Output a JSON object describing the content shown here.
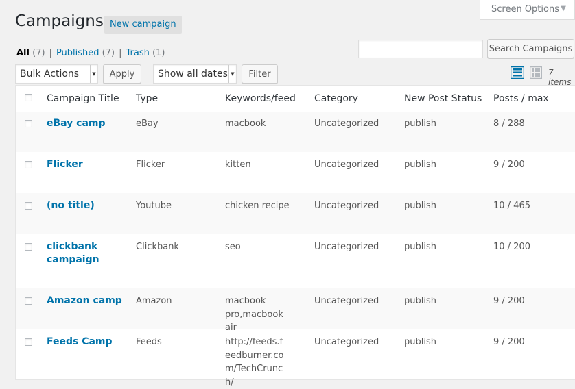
{
  "header": {
    "title": "Campaigns",
    "new_button": "New campaign",
    "screen_options": "Screen Options"
  },
  "filters": {
    "all_label": "All",
    "all_count": "(7)",
    "published_label": "Published",
    "published_count": "(7)",
    "trash_label": "Trash",
    "trash_count": "(1)",
    "separator": "|"
  },
  "search": {
    "value": "",
    "button": "Search Campaigns"
  },
  "toolbar": {
    "bulk_actions": "Bulk Actions",
    "apply": "Apply",
    "dates": "Show all dates",
    "filter": "Filter",
    "items_count": "7 items"
  },
  "table": {
    "columns": [
      "Campaign Title",
      "Type",
      "Keywords/feed",
      "Category",
      "New Post Status",
      "Posts / max"
    ],
    "rows": [
      {
        "title": "eBay camp",
        "type": "eBay",
        "keywords": "macbook",
        "category": "Uncategorized",
        "status": "publish",
        "posts": "8 / 288"
      },
      {
        "title": "Flicker",
        "type": "Flicker",
        "keywords": "kitten",
        "category": "Uncategorized",
        "status": "publish",
        "posts": "9 / 200"
      },
      {
        "title": "(no title)",
        "type": "Youtube",
        "keywords": "chicken recipe",
        "category": "Uncategorized",
        "status": "publish",
        "posts": "10 / 465"
      },
      {
        "title": "clickbank campaign",
        "type": "Clickbank",
        "keywords": "seo",
        "category": "Uncategorized",
        "status": "publish",
        "posts": "10 / 200"
      },
      {
        "title": "Amazon camp",
        "type": "Amazon",
        "keywords": "macbook pro,macbook air",
        "category": "Uncategorized",
        "status": "publish",
        "posts": "9 / 200"
      },
      {
        "title": "Feeds Camp",
        "type": "Feeds",
        "keywords": "http://feeds.feedburner.com/TechCrunch/",
        "category": "Uncategorized",
        "status": "publish",
        "posts": "9 / 200"
      }
    ]
  },
  "icons": {
    "list_view": "list-view-icon",
    "excerpt_view": "excerpt-view-icon",
    "dropdown": "chevron-down-icon"
  },
  "colors": {
    "link": "#0073aa",
    "background": "#f1f1f1",
    "alt_row": "#f9f9f9"
  }
}
